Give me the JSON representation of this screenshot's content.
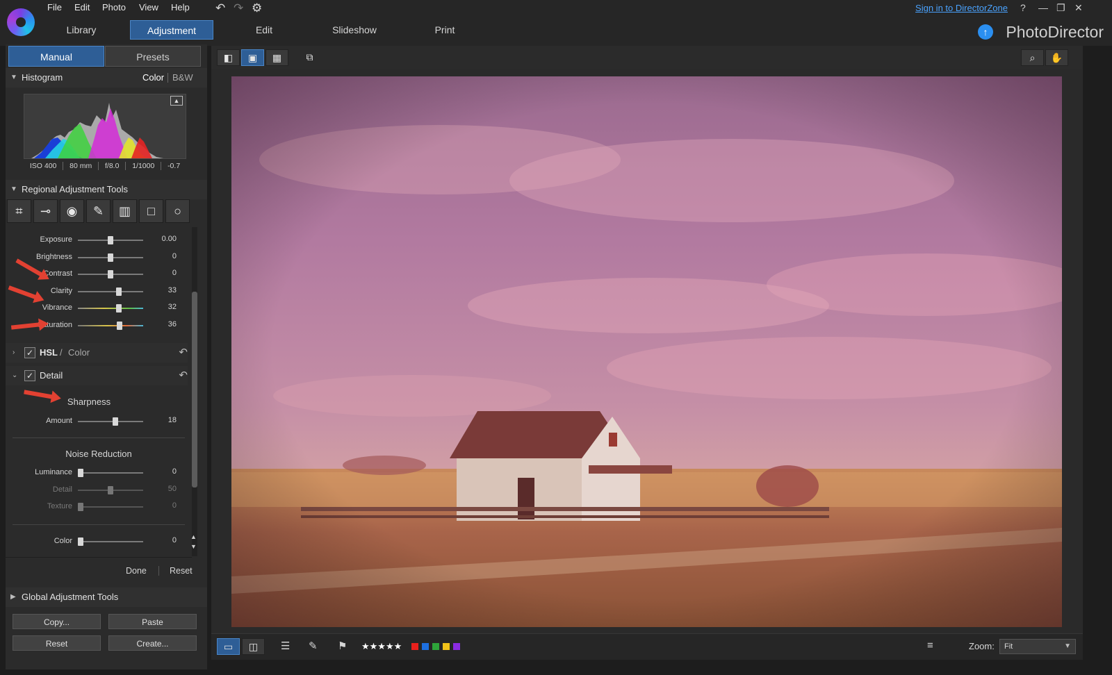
{
  "menu": [
    "File",
    "Edit",
    "Photo",
    "View",
    "Help"
  ],
  "mode_tabs": [
    "Library",
    "Adjustment",
    "Edit",
    "Slideshow",
    "Print"
  ],
  "sign_in": "Sign in to DirectorZone",
  "brand": "PhotoDirector",
  "panel_tabs": {
    "manual": "Manual",
    "presets": "Presets"
  },
  "histogram": {
    "title": "Histogram",
    "color_label": "Color",
    "bw_label": "B&W",
    "exif": [
      "ISO 400",
      "80 mm",
      "f/8.0",
      "1/1000",
      "-0.7"
    ]
  },
  "regional": {
    "title": "Regional Adjustment Tools",
    "sliders": [
      {
        "label": "Exposure",
        "value": "0.00",
        "fraction": 0.5
      },
      {
        "label": "Brightness",
        "value": "0",
        "fraction": 0.5
      },
      {
        "label": "Contrast",
        "value": "0",
        "fraction": 0.5
      },
      {
        "label": "Clarity",
        "value": "33",
        "fraction": 0.64
      },
      {
        "label": "Vibrance",
        "value": "32",
        "fraction": 0.64
      },
      {
        "label": "Saturation",
        "value": "36",
        "fraction": 0.65
      }
    ]
  },
  "hsl": {
    "title": "HSL",
    "sep": "/",
    "sub": "Color"
  },
  "detail": {
    "title": "Detail",
    "sharpness_title": "Sharpness",
    "amount": {
      "label": "Amount",
      "value": "18",
      "fraction": 0.58
    },
    "noise_title": "Noise Reduction",
    "noise": [
      {
        "label": "Luminance",
        "value": "0",
        "fraction": 0.0
      },
      {
        "label": "Detail",
        "value": "50",
        "fraction": 0.5
      },
      {
        "label": "Texture",
        "value": "0",
        "fraction": 0.0
      }
    ],
    "color": {
      "label": "Color",
      "value": "0",
      "fraction": 0.0
    }
  },
  "done_label": "Done",
  "reset_label": "Reset",
  "global": {
    "title": "Global Adjustment Tools"
  },
  "buttons": {
    "copy": "Copy...",
    "paste": "Paste",
    "reset": "Reset",
    "create": "Create..."
  },
  "rating": "★★★★★",
  "color_labels": [
    "#e8201c",
    "#1d6fe0",
    "#2ea43a",
    "#f2c31a",
    "#8a2be2"
  ],
  "zoom": {
    "label": "Zoom:",
    "value": "Fit"
  }
}
